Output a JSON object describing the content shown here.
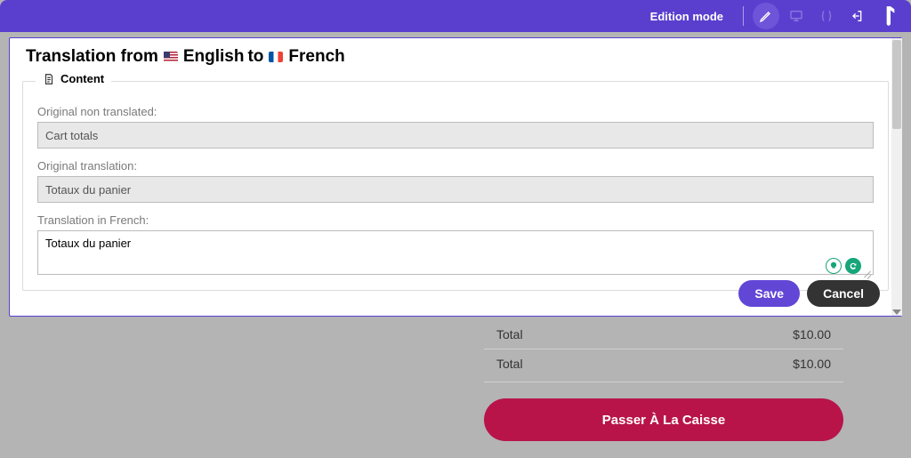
{
  "topbar": {
    "mode_label": "Edition mode"
  },
  "modal": {
    "title_prefix": "Translation from",
    "title_lang_from": "English",
    "title_mid": "to",
    "title_lang_to": "French",
    "section_label": "Content",
    "label_original": "Original non translated:",
    "value_original": "Cart totals",
    "label_orig_translation": "Original translation:",
    "value_orig_translation": "Totaux du panier",
    "label_edit": "Translation in French:",
    "value_edit": "Totaux du panier",
    "save_label": "Save",
    "cancel_label": "Cancel"
  },
  "background": {
    "rows": [
      {
        "label": "Total",
        "value": "$10.00"
      },
      {
        "label": "Total",
        "value": "$10.00"
      }
    ],
    "checkout_label": "Passer À La Caisse"
  }
}
